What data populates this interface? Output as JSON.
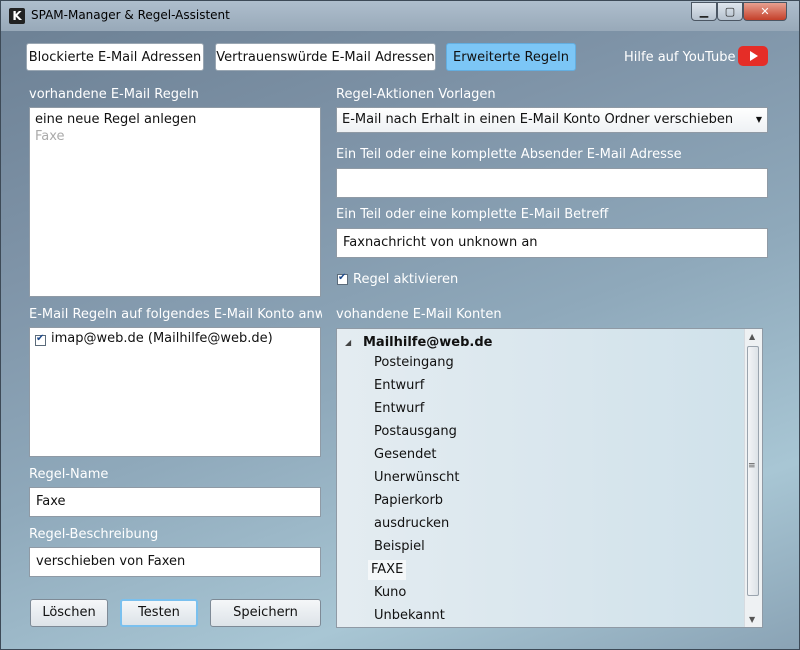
{
  "window": {
    "title": "SPAM-Manager & Regel-Assistent",
    "app_icon_glyph": "K",
    "controls": {
      "minimize": "▁",
      "maximize": "▢",
      "close": "✕"
    }
  },
  "tabs": [
    {
      "label": "Blockierte E-Mail Adressen",
      "active": false
    },
    {
      "label": "Vertrauenswürde E-Mail Adressen",
      "active": false
    },
    {
      "label": "Erweiterte Regeln",
      "active": true
    }
  ],
  "help": {
    "label": "Hilfe auf YouTube",
    "icon": "youtube-icon"
  },
  "left": {
    "rules_label": "vorhandene E-Mail Regeln",
    "rules": [
      {
        "label": "eine neue Regel anlegen",
        "muted": false
      },
      {
        "label": "Faxe",
        "muted": true
      }
    ],
    "accounts_label": "E-Mail Regeln auf folgendes E-Mail Konto anwend",
    "accounts": [
      {
        "label": "imap@web.de (Mailhilfe@web.de)",
        "checked": true
      }
    ],
    "rule_name_label": "Regel-Name",
    "rule_name_value": "Faxe",
    "rule_desc_label": "Regel-Beschreibung",
    "rule_desc_value": "verschieben von Faxen",
    "buttons": {
      "delete": "Löschen",
      "test": "Testen",
      "save": "Speichern"
    }
  },
  "right": {
    "action_templates_label": "Regel-Aktionen Vorlagen",
    "action_template_selected": "E-Mail nach Erhalt in einen E-Mail Konto Ordner verschieben",
    "sender_label": "Ein Teil oder eine komplette Absender E-Mail Adresse",
    "sender_value": "",
    "subject_label": "Ein Teil oder eine komplette E-Mail Betreff",
    "subject_value": "Faxnachricht von unknown an",
    "activate_label": "Regel aktivieren",
    "activate_checked": true,
    "accounts_tree_label": "vohandene E-Mail Konten",
    "tree_root": "Mailhilfe@web.de",
    "folders": [
      "Posteingang",
      "Entwurf",
      "Entwurf",
      "Postausgang",
      "Gesendet",
      "Unerwünscht",
      "Papierkorb",
      "ausdrucken",
      "Beispiel",
      "FAXE",
      "Kuno",
      "Unbekannt"
    ],
    "selected_folder": "FAXE"
  },
  "colors": {
    "active_tab": "#7cc6f6",
    "youtube": "#e52d27"
  }
}
